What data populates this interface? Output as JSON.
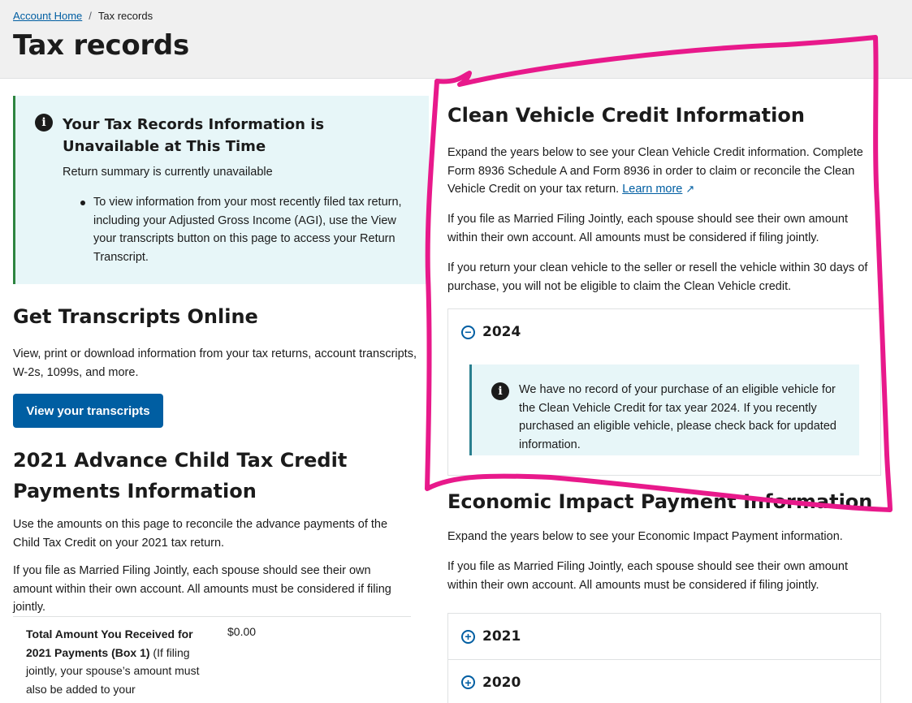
{
  "breadcrumb": {
    "home": "Account Home",
    "separator": "/",
    "current": "Tax records"
  },
  "page_title": "Tax records",
  "unavailable_alert": {
    "icon": "info-icon",
    "title": "Your Tax Records Information is Unavailable at This Time",
    "subtitle": "Return summary is currently unavailable",
    "bullet": "To view information from your most recently filed tax return, including your Adjusted Gross Income (AGI), use the View your transcripts button on this page to access your Return Transcript."
  },
  "transcripts": {
    "title": "Get Transcripts Online",
    "description": "View, print or download information from your tax returns, account transcripts, W-2s, 1099s, and more.",
    "button": "View your transcripts"
  },
  "child_tax_credit": {
    "title": "2021 Advance Child Tax Credit Payments Information",
    "para1": "Use the amounts on this page to reconcile the advance payments of the Child Tax Credit on your 2021 tax return.",
    "para2": "If you file as Married Filing Jointly, each spouse should see their own amount within their own account. All amounts must be considered if filing jointly.",
    "row_label_bold": "Total Amount You Received for 2021 Payments (Box 1)",
    "row_label_rest": " (If filing jointly, your spouse’s amount must also be added to your",
    "row_value": "$0.00"
  },
  "clean_vehicle": {
    "title": "Clean Vehicle Credit Information",
    "para1": "Expand the years below to see your Clean Vehicle Credit information. Complete Form 8936 Schedule A and Form 8936 in order to claim or reconcile the Clean Vehicle Credit on your tax return.",
    "learn_more": "Learn more",
    "para2": "If you file as Married Filing Jointly, each spouse should see their own amount within their own account. All amounts must be considered if filing jointly.",
    "para3": "If you return your clean vehicle to the seller or resell the vehicle within 30 days of purchase, you will not be eligible to claim the Clean Vehicle credit.",
    "year": "2024",
    "notice": "We have no record of your purchase of an eligible vehicle for the Clean Vehicle Credit for tax year 2024. If you recently purchased an eligible vehicle, please check back for updated information."
  },
  "economic_impact": {
    "title": "Economic Impact Payment Information",
    "para1": "Expand the years below to see your Economic Impact Payment information.",
    "para2": "If you file as Married Filing Jointly, each spouse should see their own amount within their own account. All amounts must be considered if filing jointly.",
    "years": [
      "2021",
      "2020"
    ]
  },
  "colors": {
    "primary": "#005ea2",
    "alert_bg": "#e7f6f8",
    "annotation": "#e8198b"
  }
}
